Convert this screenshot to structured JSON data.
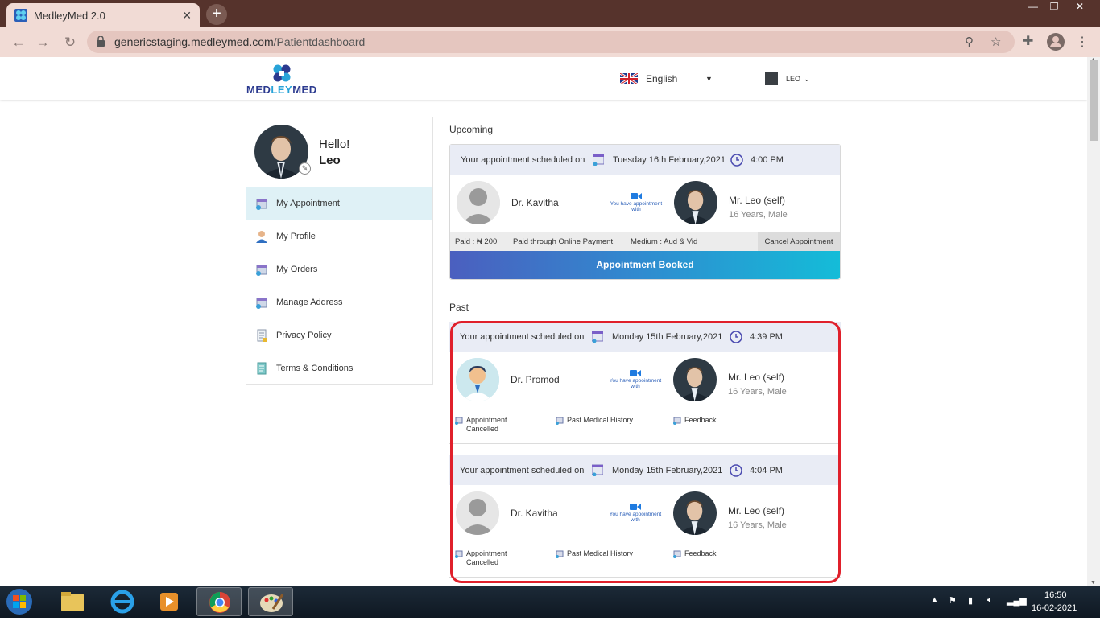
{
  "browser": {
    "tab_title": "MedleyMed 2.0",
    "tab_close": "✕",
    "new_tab": "+",
    "url_host": "genericstaging.medleymed.com",
    "url_path": "/Patientdashboard",
    "window_controls": [
      "—",
      "❐",
      "✕"
    ]
  },
  "header": {
    "logo_text_1": "MED",
    "logo_text_2": "LEY",
    "logo_text_3": "MED",
    "language": "English",
    "user": "LEO"
  },
  "sidebar": {
    "greeting": "Hello!",
    "name": "Leo",
    "items": [
      {
        "label": "My Appointment"
      },
      {
        "label": "My Profile"
      },
      {
        "label": "My Orders"
      },
      {
        "label": "Manage Address"
      },
      {
        "label": "Privacy Policy"
      },
      {
        "label": "Terms & Conditions"
      }
    ]
  },
  "upcoming": {
    "section_title": "Upcoming",
    "scheduled_label": "Your appointment scheduled on",
    "date": "Tuesday 16th February,2021",
    "time": "4:00 PM",
    "doctor": "Dr. Kavitha",
    "video_text": "You have appointment with",
    "patient": "Mr. Leo (self)",
    "patient_meta": "16 Years, Male",
    "paid": "Paid : ₦ 200",
    "paid_through": "Paid through Online Payment",
    "medium": "Medium : Aud & Vid",
    "cancel": "Cancel Appointment",
    "status": "Appointment Booked"
  },
  "past": {
    "section_title": "Past",
    "appointments": [
      {
        "scheduled_label": "Your appointment scheduled on",
        "date": "Monday 15th February,2021",
        "time": "4:39 PM",
        "doctor": "Dr. Promod",
        "video_text": "You have appointment with",
        "patient": "Mr. Leo (self)",
        "patient_meta": "16 Years, Male",
        "status_1": "Appointment",
        "status_2": "Cancelled",
        "history": "Past Medical History",
        "feedback": "Feedback"
      },
      {
        "scheduled_label": "Your appointment scheduled on",
        "date": "Monday 15th February,2021",
        "time": "4:04 PM",
        "doctor": "Dr. Kavitha",
        "video_text": "You have appointment with",
        "patient": "Mr. Leo (self)",
        "patient_meta": "16 Years, Male",
        "status_1": "Appointment",
        "status_2": "Cancelled",
        "history": "Past Medical History",
        "feedback": "Feedback"
      }
    ]
  },
  "taskbar": {
    "time": "16:50",
    "date": "16-02-2021"
  },
  "colors": {
    "accent": "#2b3a8f",
    "highlight": "#e0202b",
    "active_menu": "#dff1f6"
  }
}
